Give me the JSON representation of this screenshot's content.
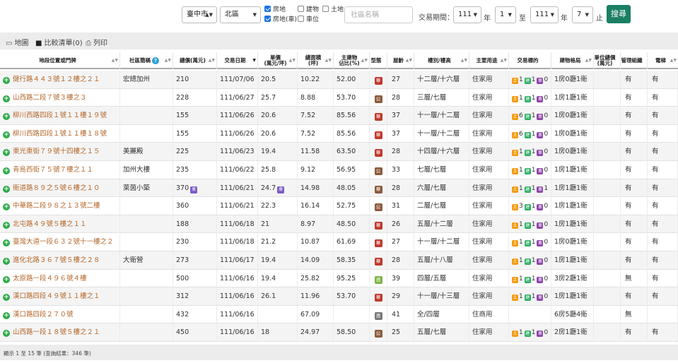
{
  "search": {
    "city": "臺中市",
    "district": "北區",
    "checkboxes": [
      {
        "label": "房地",
        "checked": true
      },
      {
        "label": "建物",
        "checked": false
      },
      {
        "label": "土地",
        "checked": false
      },
      {
        "label": "房地(車)",
        "checked": true
      },
      {
        "label": "車位",
        "checked": false
      }
    ],
    "community_placeholder": "社區名稱",
    "period_label": "交易期間：",
    "from_year": "111",
    "year_unit": "年",
    "from_month": "1",
    "to_label": "至",
    "to_year": "111",
    "to_month": "7",
    "end_label": "止",
    "search_button": "搜尋"
  },
  "toolbar": {
    "map": "地圖",
    "compare": "比較清單(0)",
    "print": "列印"
  },
  "table": {
    "headers": {
      "address": "地段位置或門牌",
      "community": "社區簡稱",
      "total_price": "總價(萬元)",
      "date": "交易日期",
      "unit_price": "單價\n(萬元/坪)",
      "area": "總面積\n(坪)",
      "main_ratio": "主建物\n佔比(%)",
      "type": "型態",
      "age": "屋齡",
      "floor": "樓別/樓高",
      "use": "主要用途",
      "target": "交易標的",
      "layout": "建物格局",
      "mgmt_fee": "單位總價\n(萬元)",
      "mgmt_org": "管理組織",
      "elevator": "電梯"
    },
    "rows": [
      {
        "address": "健行路４４３號１２樓之２１",
        "community": "宏總加州",
        "price": "210",
        "date": "111/07/06",
        "unit": "20.5",
        "area": "10.22",
        "ratio": "52.00",
        "type": "華",
        "type_color": "#c0392b",
        "age": "27",
        "floor": "十二層/十六層",
        "use": "住家用",
        "land": "1",
        "bld": "1",
        "park": "0",
        "layout": "1房0廳1衛",
        "fee": "",
        "org": "有",
        "elev": "有"
      },
      {
        "address": "山西路二段７號３樓之３",
        "community": "",
        "price": "228",
        "date": "111/06/27",
        "unit": "25.7",
        "area": "8.88",
        "ratio": "53.70",
        "type": "公",
        "type_color": "#8e5a3c",
        "age": "28",
        "floor": "三層/七層",
        "use": "住家用",
        "land": "1",
        "bld": "1",
        "park": "0",
        "layout": "1房1廳1衛",
        "fee": "",
        "org": "有",
        "elev": "有"
      },
      {
        "address": "柳川西路四段１號１１樓１９號",
        "community": "",
        "price": "155",
        "date": "111/06/26",
        "unit": "20.6",
        "area": "7.52",
        "ratio": "85.56",
        "type": "華",
        "type_color": "#c0392b",
        "age": "37",
        "floor": "十一層/十二層",
        "use": "住家用",
        "land": "6",
        "bld": "1",
        "park": "0",
        "layout": "1房0廳1衛",
        "fee": "",
        "org": "有",
        "elev": "有"
      },
      {
        "address": "柳川西路四段１號１１樓１８號",
        "community": "",
        "price": "155",
        "date": "111/06/26",
        "unit": "20.6",
        "area": "7.52",
        "ratio": "85.56",
        "type": "華",
        "type_color": "#c0392b",
        "age": "37",
        "floor": "十一層/十二層",
        "use": "住家用",
        "land": "6",
        "bld": "1",
        "park": "0",
        "layout": "1房0廳1衛",
        "fee": "",
        "org": "有",
        "elev": "有"
      },
      {
        "address": "東光東街７９號十四樓之１５",
        "community": "美麗殿",
        "price": "225",
        "date": "111/06/23",
        "unit": "19.4",
        "area": "11.58",
        "ratio": "63.50",
        "type": "華",
        "type_color": "#c0392b",
        "age": "28",
        "floor": "十四層/十六層",
        "use": "住家用",
        "land": "1",
        "bld": "1",
        "park": "0",
        "layout": "1房0廳1衛",
        "fee": "",
        "org": "有",
        "elev": "有"
      },
      {
        "address": "青島西街７５號７樓之１１",
        "community": "加州大樓",
        "price": "235",
        "date": "111/06/22",
        "unit": "25.8",
        "area": "9.12",
        "ratio": "56.95",
        "type": "公",
        "type_color": "#8e5a3c",
        "age": "33",
        "floor": "七層/七層",
        "use": "住家用",
        "land": "1",
        "bld": "1",
        "park": "0",
        "layout": "1房1廳1衛",
        "fee": "",
        "org": "有",
        "elev": "有"
      },
      {
        "address": "衛道路８９之５號６樓之１０",
        "community": "萊茵小築",
        "price": "370",
        "price_badge": "車",
        "date": "111/06/21",
        "unit": "24.7",
        "unit_badge": "車",
        "area": "14.98",
        "ratio": "48.05",
        "type": "華",
        "type_color": "#8e5a3c",
        "age": "28",
        "floor": "六層/七層",
        "use": "住家用",
        "land": "1",
        "bld": "1",
        "park": "1",
        "layout": "1房1廳1衛",
        "fee": "",
        "org": "有",
        "elev": "有"
      },
      {
        "address": "中華路二段９８之１３號二樓",
        "community": "",
        "price": "360",
        "date": "111/06/21",
        "unit": "22.3",
        "area": "16.14",
        "ratio": "52.75",
        "type": "公",
        "type_color": "#8e5a3c",
        "age": "31",
        "floor": "二層/七層",
        "use": "住家用",
        "land": "3",
        "bld": "1",
        "park": "0",
        "layout": "1房1廳1衛",
        "fee": "",
        "org": "有",
        "elev": "有"
      },
      {
        "address": "北屯路４９號５樓之１１",
        "community": "",
        "price": "188",
        "date": "111/06/18",
        "unit": "21",
        "area": "8.97",
        "ratio": "48.50",
        "type": "華",
        "type_color": "#c0392b",
        "age": "26",
        "floor": "五層/十二層",
        "use": "住家用",
        "land": "1",
        "bld": "1",
        "park": "0",
        "layout": "1房1廳1衛",
        "fee": "",
        "org": "有",
        "elev": "有"
      },
      {
        "address": "臺灣大道一段６３２號十一樓之２",
        "community": "",
        "price": "230",
        "date": "111/06/18",
        "unit": "21.2",
        "area": "10.87",
        "ratio": "61.69",
        "type": "華",
        "type_color": "#c0392b",
        "age": "27",
        "floor": "十一層/十二層",
        "use": "住家用",
        "land": "1",
        "bld": "1",
        "park": "0",
        "layout": "1房0廳1衛",
        "fee": "",
        "org": "有",
        "elev": "有"
      },
      {
        "address": "進化北路３６７號５樓之２８",
        "community": "大衛營",
        "price": "273",
        "date": "111/06/17",
        "unit": "19.4",
        "area": "14.09",
        "ratio": "58.35",
        "type": "華",
        "type_color": "#c0392b",
        "age": "28",
        "floor": "五層/十八層",
        "use": "住家用",
        "land": "1",
        "bld": "1",
        "park": "0",
        "layout": "1房1廳1衛",
        "fee": "",
        "org": "有",
        "elev": "有"
      },
      {
        "address": "太原路一段４９６號４樓",
        "community": "",
        "price": "500",
        "date": "111/06/16",
        "unit": "19.4",
        "area": "25.82",
        "ratio": "95.25",
        "type": "透",
        "type_color": "#7cb342",
        "age": "39",
        "floor": "四層/五層",
        "use": "住家用",
        "land": "1",
        "bld": "1",
        "park": "0",
        "layout": "3房2廳1衛",
        "fee": "",
        "org": "無",
        "elev": "有"
      },
      {
        "address": "漢口路四段４９號１１樓之１",
        "community": "",
        "price": "312",
        "date": "111/06/16",
        "unit": "26.1",
        "area": "11.96",
        "ratio": "53.70",
        "type": "華",
        "type_color": "#c0392b",
        "age": "29",
        "floor": "十一層/十三層",
        "use": "住家用",
        "land": "1",
        "bld": "1",
        "park": "0",
        "layout": "1房1廳1衛",
        "fee": "",
        "org": "有",
        "elev": "有"
      },
      {
        "address": "漢口路四段２７０號",
        "community": "",
        "price": "432",
        "date": "111/06/16",
        "unit": "",
        "area": "67.09",
        "ratio": "",
        "type": "透",
        "type_color": "#777777",
        "age": "41",
        "floor": "全/四層",
        "use": "住商用",
        "land": "",
        "bld": "",
        "park": "",
        "layout": "6房5廳4衛",
        "fee": "",
        "org": "無",
        "elev": ""
      },
      {
        "address": "山西路一段１８號５樓之２１",
        "community": "",
        "price": "450",
        "date": "111/06/16",
        "unit": "18",
        "area": "24.97",
        "ratio": "58.50",
        "type": "公",
        "type_color": "#8e5a3c",
        "age": "25",
        "floor": "五層/七層",
        "use": "住家用",
        "land": "1",
        "bld": "1",
        "park": "0",
        "layout": "2房1廳1衛",
        "fee": "",
        "org": "有",
        "elev": "有"
      }
    ]
  },
  "footer": "顯示 1 至 15 筆 (查詢結果：346 筆)"
}
